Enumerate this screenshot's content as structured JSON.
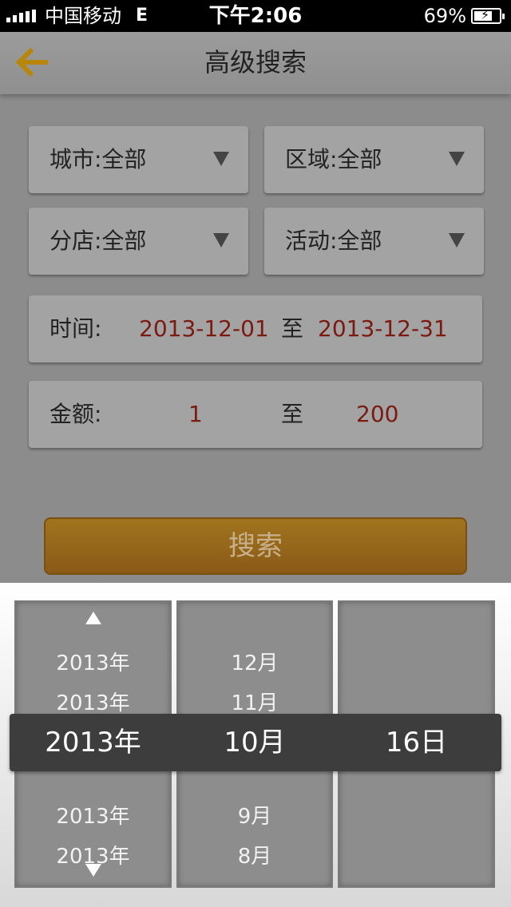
{
  "status_bar": {
    "carrier": "中国移动",
    "network": "E",
    "time": "下午2:06",
    "battery": "69%"
  },
  "nav": {
    "title": "高级搜索",
    "back_icon": "back-arrow-icon",
    "accent_color": "#b8860b"
  },
  "filters": {
    "city": "城市:全部",
    "area": "区域:全部",
    "branch": "分店:全部",
    "activity": "活动:全部"
  },
  "time_range": {
    "label": "时间:",
    "from": "2013-12-01",
    "sep": "至",
    "to": "2013-12-31"
  },
  "amount_range": {
    "label": "金额:",
    "from": "1",
    "sep": "至",
    "to": "200"
  },
  "search_button": "搜索",
  "picker": {
    "years_above": [
      "2013年",
      "2013年"
    ],
    "years_below": [
      "2013年",
      "2013年"
    ],
    "months_above": [
      "12月",
      "11月"
    ],
    "months_below": [
      "9月",
      "8月"
    ],
    "selected": {
      "year": "2013年",
      "month": "10月",
      "day": "16日"
    }
  }
}
